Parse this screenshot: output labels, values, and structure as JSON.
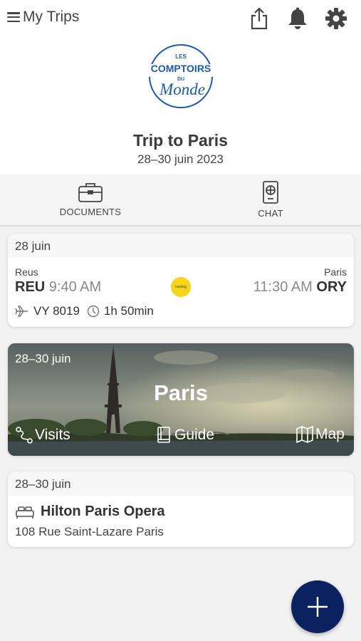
{
  "header": {
    "title": "My Trips",
    "icons": [
      "share-icon",
      "bell-icon",
      "gear-icon"
    ]
  },
  "logo": {
    "line1": "LES",
    "line2": "COMPTOIRS",
    "line3": "DU",
    "line4": "Monde",
    "color": "#1f5aa8"
  },
  "trip": {
    "title": "Trip to Paris",
    "dates": "28–30 juin 2023"
  },
  "tabs": [
    {
      "label": "DOCUMENTS",
      "icon": "briefcase-icon"
    },
    {
      "label": "CHAT",
      "icon": "passport-icon"
    }
  ],
  "flight": {
    "date": "28 juin",
    "from_city": "Reus",
    "from_code": "REU",
    "dep_time": "9:40 AM",
    "to_city": "Paris",
    "to_code": "ORY",
    "arr_time": "11:30 AM",
    "airline_logo_text": "vueling",
    "flight_number": "VY 8019",
    "duration": "1h 50min"
  },
  "destination": {
    "dates": "28–30 juin",
    "name": "Paris",
    "actions": {
      "visits": "Visits",
      "guide": "Guide",
      "map": "Map"
    }
  },
  "hotel": {
    "date": "28–30 juin",
    "name": "Hilton Paris Opera",
    "address": "108 Rue Saint-Lazare Paris"
  },
  "colors": {
    "fab": "#0c2160",
    "airline": "#f7d417",
    "brand": "#1f5aa8"
  }
}
